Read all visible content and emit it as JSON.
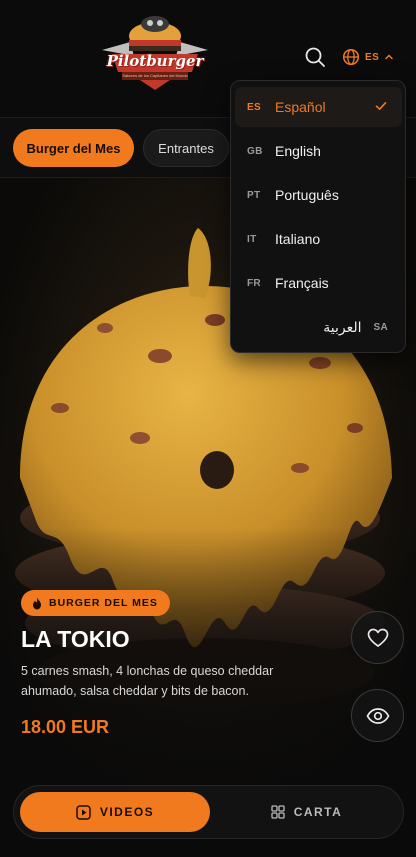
{
  "header": {
    "logo_text": "Pilotburger",
    "logo_subtitle": "Sabores de los Capitanes del Mundo",
    "language_code": "ES"
  },
  "tabs": [
    {
      "label": "Burger del Mes",
      "active": true
    },
    {
      "label": "Entrantes",
      "active": false
    }
  ],
  "language_menu": {
    "items": [
      {
        "code": "ES",
        "label": "Español",
        "selected": true
      },
      {
        "code": "GB",
        "label": "English",
        "selected": false
      },
      {
        "code": "PT",
        "label": "Português",
        "selected": false
      },
      {
        "code": "IT",
        "label": "Italiano",
        "selected": false
      },
      {
        "code": "FR",
        "label": "Français",
        "selected": false
      },
      {
        "code": "SA",
        "label": "العربية",
        "selected": false
      }
    ]
  },
  "product": {
    "badge": "BURGER DEL MES",
    "title": "LA TOKIO",
    "description": "5 carnes smash, 4 lonchas de queso cheddar ahumado, salsa cheddar y bits de bacon.",
    "price": "18.00 EUR"
  },
  "bottom_nav": {
    "videos_label": "VIDEOS",
    "carta_label": "CARTA"
  },
  "colors": {
    "accent": "#f27a1e",
    "background": "#0b0b0b"
  },
  "icons": {
    "search": "search-icon",
    "language": "globe-icon",
    "chevron": "chevron-up-icon",
    "check": "check-icon",
    "badge": "flame-icon",
    "favorite": "heart-icon",
    "view": "eye-icon",
    "videos": "play-square-icon",
    "carta": "grid-icon"
  }
}
